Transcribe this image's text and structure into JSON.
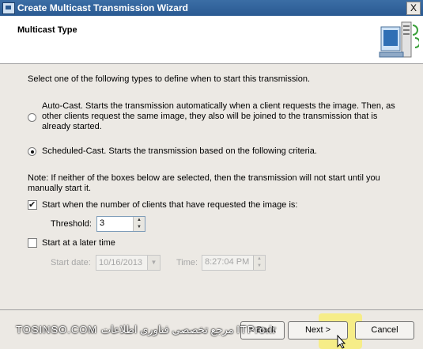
{
  "window": {
    "title": "Create Multicast Transmission Wizard",
    "close_glyph": "X"
  },
  "header": {
    "heading": "Multicast Type"
  },
  "main": {
    "intro": "Select one of the following types to define when to start this transmission.",
    "options": [
      {
        "label": "Auto-Cast. Starts the transmission automatically when a client requests the image. Then, as other clients request the same image, they also will be joined to the transmission that is already started.",
        "selected": false
      },
      {
        "label": "Scheduled-Cast. Starts the transmission based on the following criteria.",
        "selected": true
      }
    ],
    "note": "Note: If neither of the boxes below are selected, then the transmission will not start until you manually start it.",
    "clients_checkbox": {
      "label": "Start when the number of clients that have requested the image is:",
      "checked": true
    },
    "threshold": {
      "label": "Threshold:",
      "value": "3"
    },
    "later_checkbox": {
      "label": "Start at a later time",
      "checked": false
    },
    "start_date": {
      "label": "Start date:",
      "value": "10/16/2013"
    },
    "time": {
      "label": "Time:",
      "value": "8:27:04 PM"
    }
  },
  "footer": {
    "back_label": "< Back",
    "next_label": "Next >",
    "cancel_label": "Cancel",
    "watermark": "TOSINSO.COM  مرجع تخصصی فناوری اطلاعات  ITPro.ir"
  },
  "colors": {
    "titlebar": "#2a5a92",
    "dialog": "#ece9e4",
    "highlight": "#fff03c"
  }
}
